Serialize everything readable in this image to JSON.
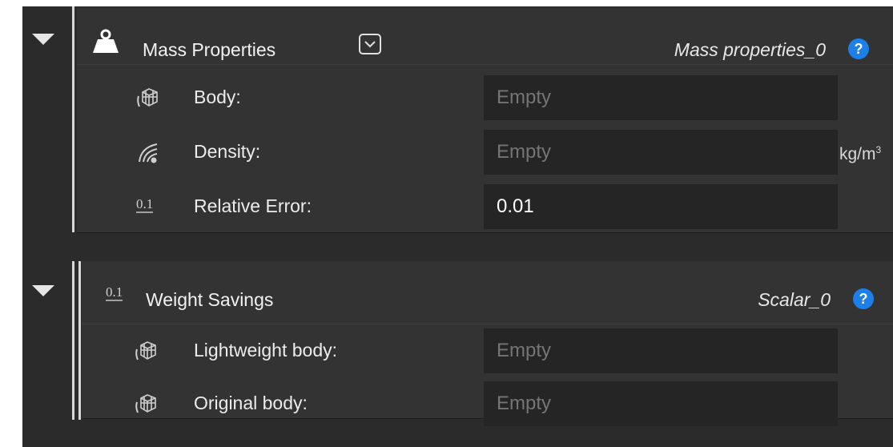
{
  "mass_properties": {
    "title": "Mass Properties",
    "instance_name": "Mass properties_0",
    "help": "?",
    "header_icon": "weight-icon",
    "rows": [
      {
        "label": "Body:",
        "value": "",
        "placeholder": "Empty",
        "icon": "body-mesh-icon"
      },
      {
        "label": "Density:",
        "value": "",
        "placeholder": "Empty",
        "icon": "density-icon",
        "unit_base": "kg/m",
        "unit_sup": "3"
      },
      {
        "label": "Relative Error:",
        "value": "0.01",
        "placeholder": "",
        "icon": "scalar-icon"
      }
    ]
  },
  "weight_savings": {
    "title": "Weight Savings",
    "instance_name": "Scalar_0",
    "help": "?",
    "header_icon": "scalar-icon",
    "rows": [
      {
        "label": "Lightweight body:",
        "value": "",
        "placeholder": "Empty",
        "icon": "body-mesh-icon"
      },
      {
        "label": "Original body:",
        "value": "",
        "placeholder": "Empty",
        "icon": "body-mesh-icon"
      }
    ]
  },
  "glyphs": {
    "scalar": "0.1"
  },
  "colors": {
    "background": "#2b2b2b",
    "node": "#333333",
    "field": "#252525",
    "accent": "#1d7fe8",
    "placeholder_text": "#6e6e6e"
  }
}
